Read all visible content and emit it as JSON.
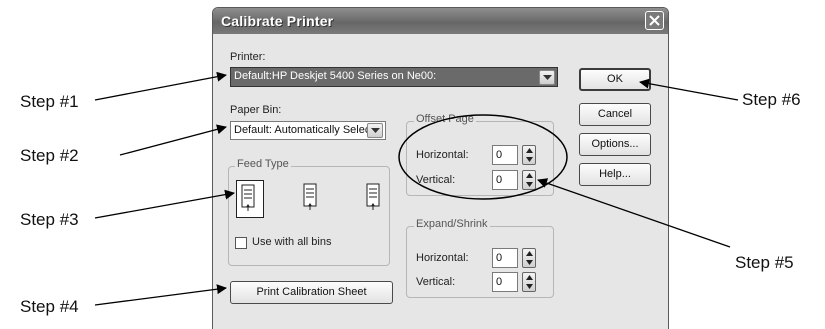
{
  "dialog": {
    "title": "Calibrate Printer",
    "printer_label": "Printer:",
    "printer_value": "Default:HP Deskjet 5400 Series on Ne00:",
    "paper_bin_label": "Paper Bin:",
    "paper_bin_value": "Default: Automatically Selec",
    "feed_type_title": "Feed Type",
    "use_all_bins_label": "Use with all bins",
    "print_calibration_label": "Print Calibration Sheet",
    "offset_page_title": "Offset Page",
    "offset_horizontal_label": "Horizontal:",
    "offset_horizontal_value": "0",
    "offset_vertical_label": "Vertical:",
    "offset_vertical_value": "0",
    "expand_shrink_title": "Expand/Shrink",
    "expand_horizontal_label": "Horizontal:",
    "expand_horizontal_value": "0",
    "expand_vertical_label": "Vertical:",
    "expand_vertical_value": "0",
    "buttons": {
      "ok": "OK",
      "cancel": "Cancel",
      "options": "Options...",
      "help": "Help..."
    }
  },
  "steps": {
    "s1": "Step #1",
    "s2": "Step #2",
    "s3": "Step #3",
    "s4": "Step #4",
    "s5": "Step #5",
    "s6": "Step #6"
  }
}
